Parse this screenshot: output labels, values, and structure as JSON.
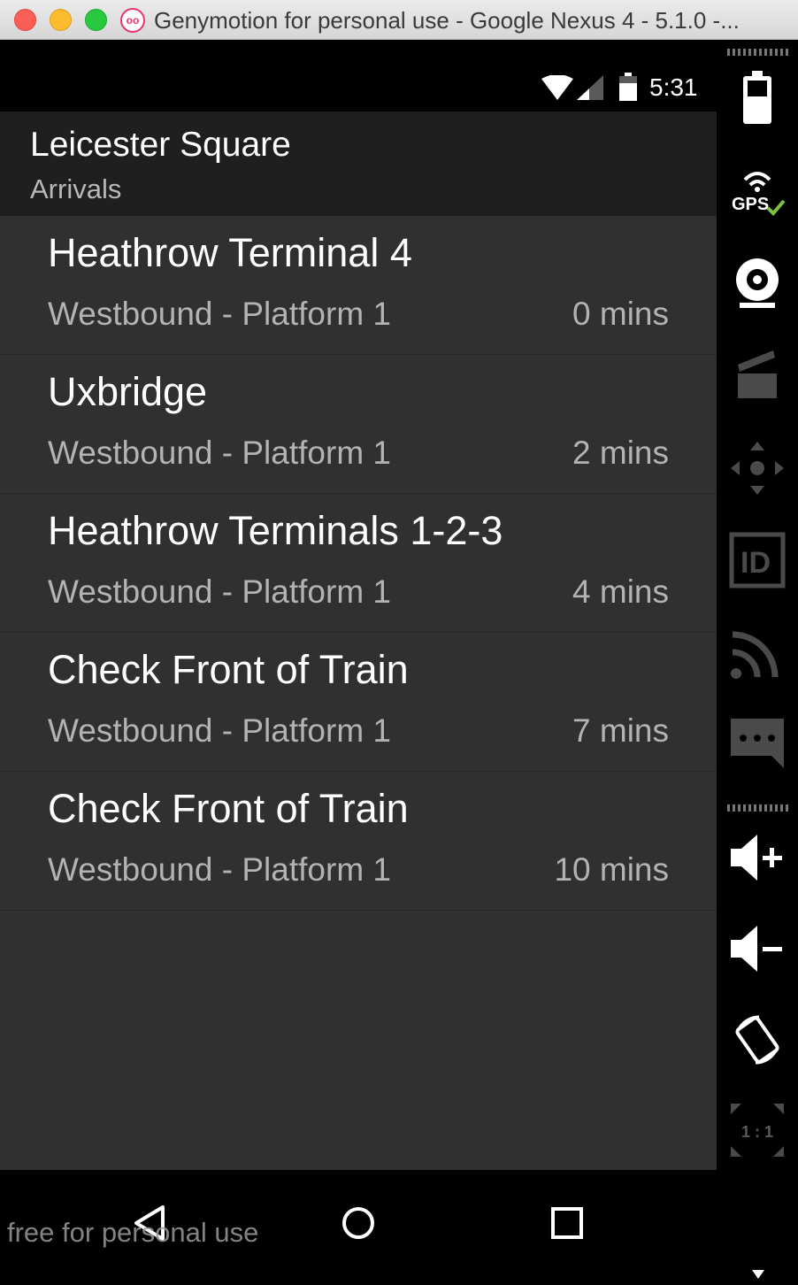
{
  "window": {
    "title": "Genymotion for personal use - Google Nexus 4 - 5.1.0 -...",
    "app_logo_text": "oo"
  },
  "status_bar": {
    "time": "5:31"
  },
  "action_bar": {
    "title": "Leicester Square",
    "subtitle": "Arrivals"
  },
  "arrivals": [
    {
      "destination": "Heathrow Terminal 4",
      "platform": "Westbound - Platform 1",
      "eta": "0 mins"
    },
    {
      "destination": "Uxbridge",
      "platform": "Westbound - Platform 1",
      "eta": "2 mins"
    },
    {
      "destination": "Heathrow Terminals 1-2-3",
      "platform": "Westbound - Platform 1",
      "eta": "4 mins"
    },
    {
      "destination": "Check Front of Train",
      "platform": "Westbound - Platform 1",
      "eta": "7 mins"
    },
    {
      "destination": "Check Front of Train",
      "platform": "Westbound - Platform 1",
      "eta": "10 mins"
    }
  ],
  "watermark": "free for personal use",
  "sidebar": {
    "gps_label": "GPS",
    "id_label": "ID",
    "pixel_ratio_label": "1 : 1",
    "icons": [
      "battery-icon",
      "gps-icon",
      "webcam-icon",
      "capture-icon",
      "dpad-icon",
      "device-id-icon",
      "network-icon",
      "sms-icon",
      "volume-up-icon",
      "volume-down-icon",
      "rotate-icon",
      "pixel-perfect-icon"
    ]
  },
  "colors": {
    "background": "#303030",
    "action_bar": "#1f1f1f",
    "primary_text": "#ffffff",
    "secondary_text": "#b3b3b3"
  }
}
